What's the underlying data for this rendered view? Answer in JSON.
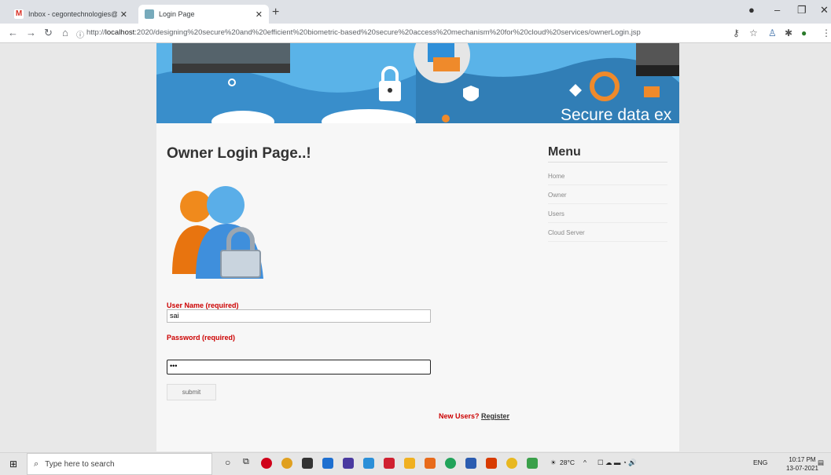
{
  "browser": {
    "tabs": [
      {
        "title": "Inbox - cegontechnologies@gm",
        "active": false
      },
      {
        "title": "Login Page",
        "active": true
      }
    ],
    "url_prefix": "http://",
    "url_host": "localhost",
    "url_rest": ":2020/designing%20secure%20and%20efficient%20biometric-based%20secure%20access%20mechanism%20for%20cloud%20services/ownerLogin.jsp"
  },
  "banner": {
    "text": "Secure data ex"
  },
  "main": {
    "title": "Owner Login Page..!",
    "username_label": "User Name (required)",
    "username_value": "sai",
    "password_label": "Password (required)",
    "password_value": "•••",
    "submit_label": "submit",
    "new_users_label": "New Users?",
    "register_label": "Register"
  },
  "menu": {
    "title": "Menu",
    "items": [
      {
        "label": "Home"
      },
      {
        "label": "Owner"
      },
      {
        "label": "Users"
      },
      {
        "label": "Cloud Server"
      }
    ]
  },
  "taskbar": {
    "search_placeholder": "Type here to search",
    "weather": "28°C",
    "lang": "ENG",
    "time": "10:17 PM",
    "date": "13-07-2021"
  },
  "colors": {
    "accent_red": "#cc0000",
    "banner_blue": "#5ab3e8"
  }
}
